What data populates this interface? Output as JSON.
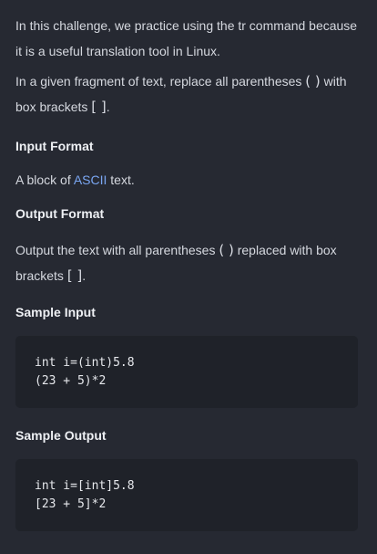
{
  "intro": {
    "text": "In this challenge, we practice using the tr command because it is a useful translation tool in Linux."
  },
  "task": {
    "before": "In a given fragment of text, replace all parentheses ",
    "parens": "( )",
    "middle": " with box brackets ",
    "brackets": "[ ]",
    "after": "."
  },
  "input_format": {
    "heading": "Input Format",
    "before": "A block of ",
    "link": "ASCII",
    "after": " text."
  },
  "output_format": {
    "heading": "Output Format",
    "before": "Output the text with all parentheses ",
    "parens": "( )",
    "middle": " replaced with box brackets ",
    "brackets": "[ ]",
    "after": "."
  },
  "sample_input": {
    "heading": "Sample Input",
    "lines": [
      "int i=(int)5.8",
      "(23 + 5)*2"
    ]
  },
  "sample_output": {
    "heading": "Sample Output",
    "lines": [
      "int i=[int]5.8",
      "[23 + 5]*2"
    ]
  },
  "colors": {
    "background": "#262932",
    "code_background": "#1f2229",
    "link": "#7aa6f2"
  }
}
